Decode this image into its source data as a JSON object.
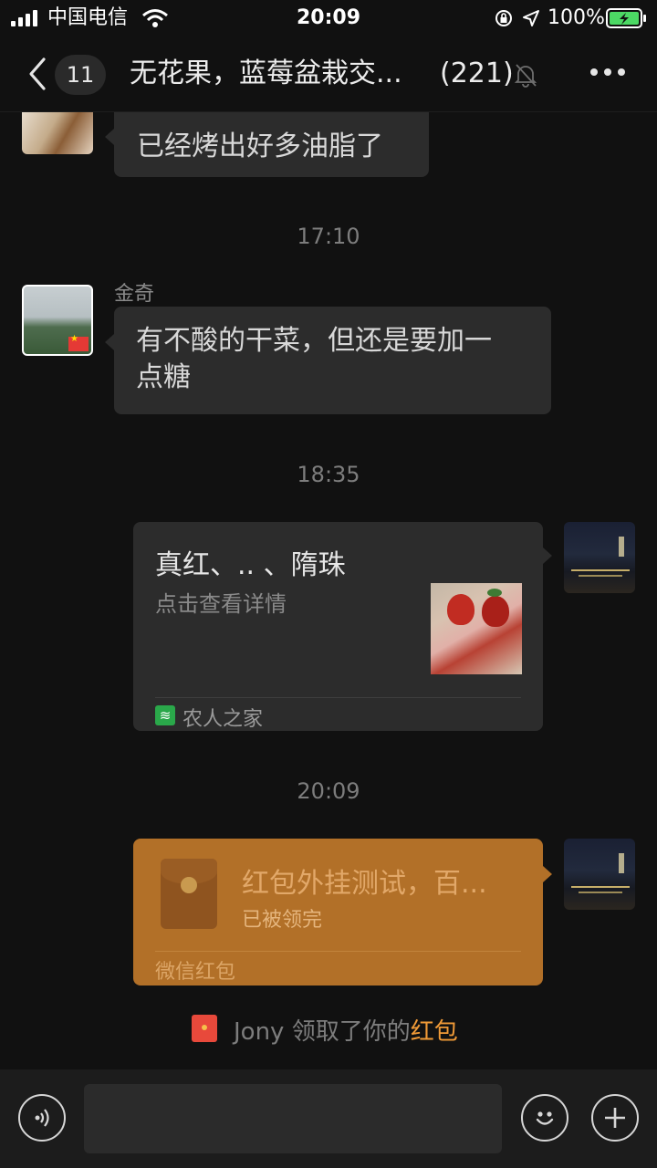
{
  "status_bar": {
    "carrier": "中国电信",
    "time": "20:09",
    "battery": "100%"
  },
  "header": {
    "unread_count": "11",
    "title": "无花果，蓝莓盆栽交...",
    "member_count": "(221)"
  },
  "messages": [
    {
      "type": "text",
      "direction": "in",
      "text": "已经烤出好多油脂了"
    },
    {
      "type": "time",
      "text": "17:10"
    },
    {
      "type": "text",
      "direction": "in",
      "sender": "金奇",
      "text_line1": "有不酸的干菜，但还是要加一",
      "text_line2": "点糖"
    },
    {
      "type": "time",
      "text": "18:35"
    },
    {
      "type": "link",
      "direction": "out",
      "title": "真红、.. 、隋珠",
      "subtitle": "点击查看详情",
      "source": "农人之家"
    },
    {
      "type": "time",
      "text": "20:09"
    },
    {
      "type": "red_packet",
      "direction": "out",
      "title": "红包外挂测试，百...",
      "status": "已被领完",
      "footer": "微信红包"
    },
    {
      "type": "system",
      "prefix": "Jony 领取了你的",
      "link": "红包"
    }
  ],
  "icons": {
    "back": "chevron-left-icon",
    "mute": "bell-slash-icon",
    "more": "more-dots-icon",
    "voice": "voice-icon",
    "emoji": "emoji-icon",
    "plus": "plus-icon"
  },
  "colors": {
    "background": "#111111",
    "bubble": "#2c2c2c",
    "red_packet": "#b27028",
    "link_orange": "#f09a37",
    "battery_green": "#4cd964"
  }
}
